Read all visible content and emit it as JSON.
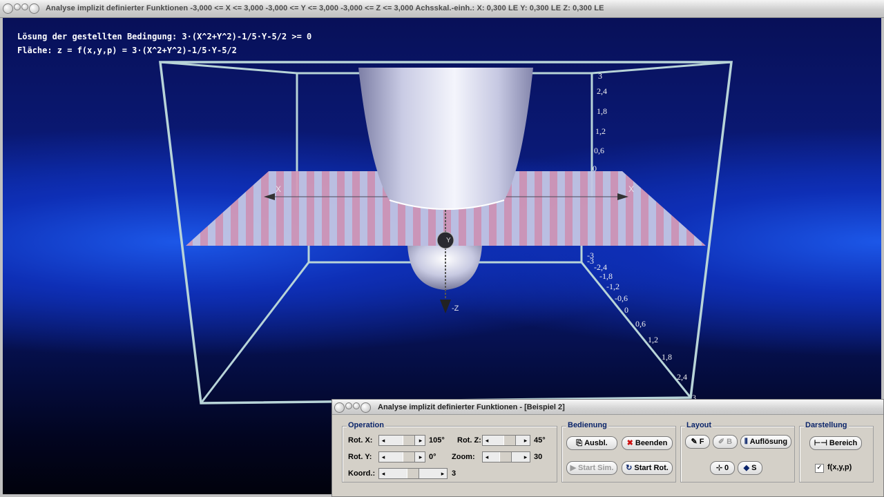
{
  "window": {
    "title": "Analyse implizit definierter Funktionen   -3,000 <= X <= 3,000  -3,000 <= Y <= 3,000  -3,000 <= Z <= 3,000  Achsskal.-einh.: X: 0,300 LE   Y: 0,300 LE   Z: 0,300 LE"
  },
  "info": {
    "condition": "Lösung der gestellten Bedingung: 3·(X^2+Y^2)-1/5·Y-5/2 >= 0",
    "surface": "Fläche: z = f(x,y,p) = 3·(X^2+Y^2)-1/5·Y-5/2"
  },
  "scene": {
    "axes": {
      "x_left": "X",
      "x_right": "X",
      "y": "Y",
      "z_neg": "-Z"
    },
    "z_ticks": [
      "3",
      "2,4",
      "1,8",
      "1,2",
      "0,6",
      "0"
    ],
    "diag_ticks": [
      "-3",
      "-3",
      "-2,4",
      "-1,8",
      "-1,2",
      "-0,6",
      "0",
      "0,6",
      "1,2",
      "1,8",
      "2,4",
      "3"
    ],
    "colors": {
      "surface": "#e8eaf6",
      "plane_stripe": "#d49ab8",
      "plane_base": "#c3c6e4",
      "box": "#b8d4d8"
    }
  },
  "panel": {
    "title": "Analyse implizit definierter Funktionen - [Beispiel 2]",
    "operation": {
      "label": "Operation",
      "rot_x_label": "Rot. X:",
      "rot_x_value": "105°",
      "rot_y_label": "Rot. Y:",
      "rot_y_value": "0°",
      "rot_z_label": "Rot. Z:",
      "rot_z_value": "45°",
      "zoom_label": "Zoom:",
      "zoom_value": "30",
      "koord_label": "Koord.:",
      "koord_value": "3"
    },
    "bedienung": {
      "label": "Bedienung",
      "ausbl": "Ausbl.",
      "beenden": "Beenden",
      "start_sim": "Start Sim.",
      "start_rot": "Start Rot."
    },
    "layout": {
      "label": "Layout",
      "f": "F",
      "b": "B",
      "aufloesung": "Auflösung",
      "zero": "0",
      "s": "S"
    },
    "darstellung": {
      "label": "Darstellung",
      "bereich": "Bereich",
      "checkbox_label": "f(x,y,p)",
      "checked": true
    }
  }
}
